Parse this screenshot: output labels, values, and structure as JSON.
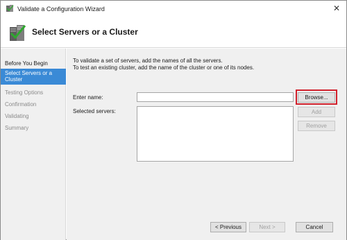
{
  "window": {
    "title": "Validate a Configuration Wizard",
    "close_glyph": "✕"
  },
  "header": {
    "title": "Select Servers or a Cluster",
    "icon": "cluster-checklist-icon"
  },
  "sidebar": {
    "items": [
      {
        "label": "Before You Begin",
        "state": "done"
      },
      {
        "label": "Select Servers or a Cluster",
        "state": "active"
      },
      {
        "label": "Testing Options",
        "state": "pending"
      },
      {
        "label": "Confirmation",
        "state": "pending"
      },
      {
        "label": "Validating",
        "state": "pending"
      },
      {
        "label": "Summary",
        "state": "pending"
      }
    ]
  },
  "main": {
    "instruction_line1": "To validate a set of servers, add the names of all the servers.",
    "instruction_line2": "To test an existing cluster, add the name of the cluster or one of its nodes.",
    "enter_name_label": "Enter name:",
    "enter_name_value": "",
    "selected_servers_label": "Selected servers:",
    "browse_label": "Browse...",
    "add_label": "Add",
    "remove_label": "Remove"
  },
  "footer": {
    "previous_label": "< Previous",
    "next_label": "Next >",
    "cancel_label": "Cancel"
  },
  "colors": {
    "accent": "#3a8ad6",
    "highlight": "#d0202b"
  }
}
